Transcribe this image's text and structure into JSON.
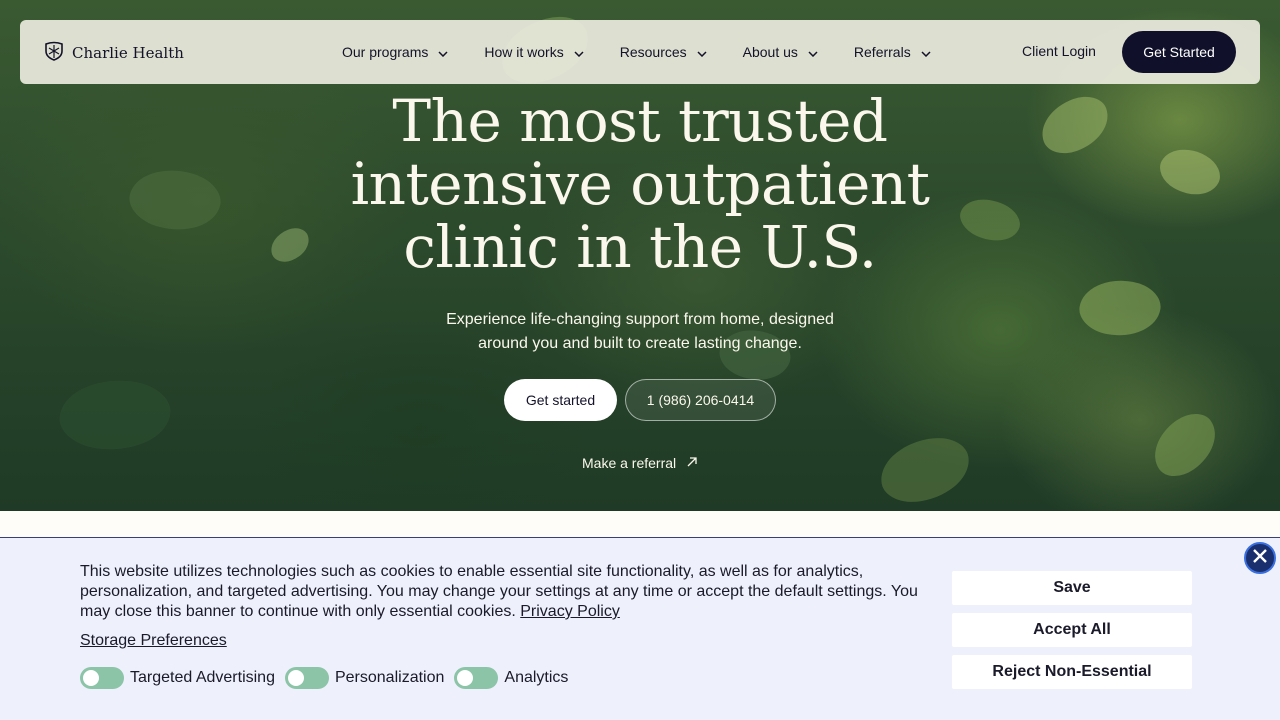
{
  "brand": {
    "name": "Charlie Health"
  },
  "nav": {
    "items": [
      {
        "label": "Our programs"
      },
      {
        "label": "How it works"
      },
      {
        "label": "Resources"
      },
      {
        "label": "About us"
      },
      {
        "label": "Referrals"
      }
    ],
    "client_login": "Client Login",
    "get_started": "Get Started"
  },
  "hero": {
    "headline_line1": "The most trusted",
    "headline_line2": "intensive outpatient",
    "headline_line3": "clinic in the U.S.",
    "subhead": "Experience life-changing support from home, designed around you and built to create lasting change.",
    "primary_cta": "Get started",
    "phone_cta": "1 (986) 206-0414",
    "referral_link": "Make a referral"
  },
  "cookie_banner": {
    "text": "This website utilizes technologies such as cookies to enable essential site functionality, as well as for analytics, personalization, and targeted advertising. You may change your settings at any time or accept the default settings. You may close this banner to continue with only essential cookies.",
    "privacy_link": "Privacy Policy",
    "storage_preferences": "Storage Preferences",
    "toggles": [
      {
        "label": "Targeted Advertising"
      },
      {
        "label": "Personalization"
      },
      {
        "label": "Analytics"
      }
    ],
    "buttons": {
      "save": "Save",
      "accept_all": "Accept All",
      "reject": "Reject Non-Essential"
    }
  },
  "colors": {
    "nav_bg": "#ecece0",
    "dark_button": "#10102a",
    "cookie_bg": "#eef0fb",
    "toggle_on": "#8cc4a8",
    "close_button": "#1a2f6e"
  }
}
